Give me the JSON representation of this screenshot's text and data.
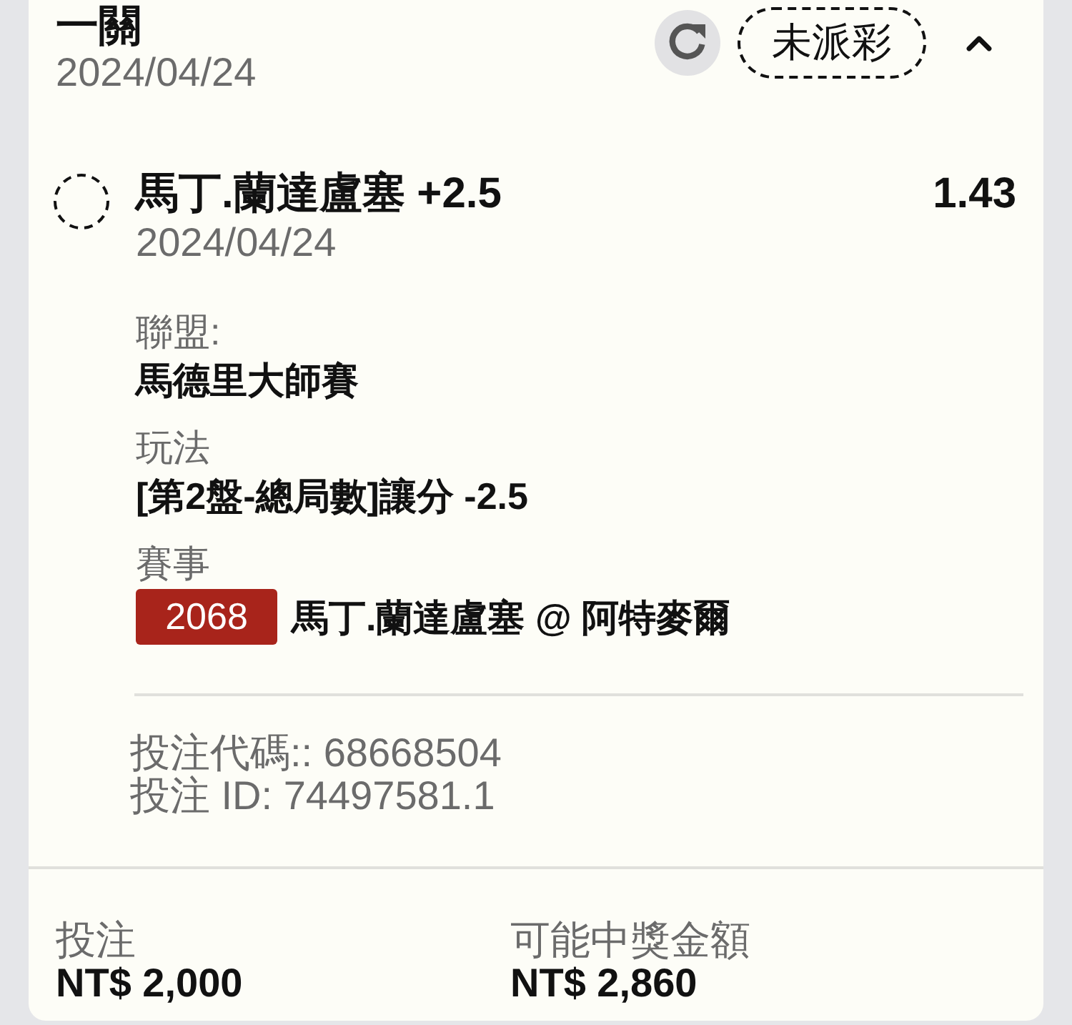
{
  "bet": {
    "title": "一關",
    "date": "2024/04/24",
    "status": "未派彩",
    "expanded": true
  },
  "selection": {
    "name": "馬丁.蘭達盧塞 +2.5",
    "odds": "1.43",
    "date": "2024/04/24"
  },
  "details": [
    {
      "kind": "text",
      "label": "聯盟:",
      "value": "馬德里大師賽"
    },
    {
      "kind": "text",
      "label": "玩法",
      "value": "[第2盤-總局數]讓分 -2.5"
    },
    {
      "kind": "event",
      "label": "賽事",
      "code": "2068",
      "value": "馬丁.蘭達盧塞 @ 阿特麥爾"
    }
  ],
  "codes": [
    "投注代碼:: 68668504",
    "投注 ID: 74497581.1"
  ],
  "totals": [
    {
      "label": "投注",
      "value": "NT$ 2,000"
    },
    {
      "label": "可能中獎金額",
      "value": "NT$ 2,860"
    }
  ]
}
